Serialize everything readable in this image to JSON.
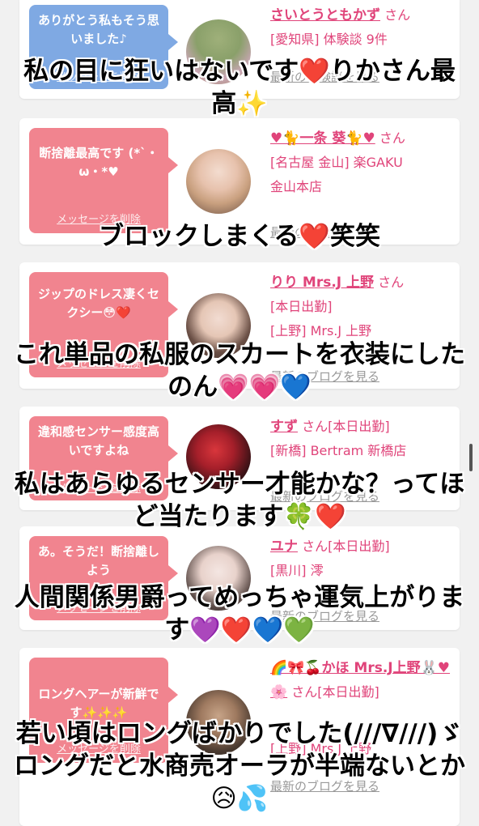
{
  "cards": [
    {
      "bubble_color": "blue",
      "message": "ありがとう私もそう思いました♪",
      "delete": "メッセージを削除",
      "name": "さいとうともかず",
      "san": "さん",
      "tags": [
        "[愛知県] 体験談 9件"
      ],
      "blog": "最新の体験談を見る"
    },
    {
      "bubble_color": "pink",
      "message": "断捨離最高です (*ˋ・ω・*♥",
      "delete": "メッセージを削除",
      "name": "♥🐈一条 葵🐈♥",
      "san": "さん",
      "tags": [
        "[名古屋 金山] 楽GAKU",
        "金山本店"
      ],
      "blog": "最新のブログを見る"
    },
    {
      "bubble_color": "pink",
      "message": "ジップのドレス凄くセクシー😳❤️",
      "delete": "メッセージを削除",
      "name": "りり Mrs.J 上野",
      "san": "さん",
      "tags": [
        "[本日出勤]",
        "[上野] Mrs.J 上野"
      ],
      "blog": "最新のブログを見る"
    },
    {
      "bubble_color": "pink",
      "message": "違和感センサー感度高いですよね",
      "delete": "メッセージを削除",
      "name": "すず",
      "san": "さん[本日出勤]",
      "tags": [
        "[新橋] Bertram 新橋店"
      ],
      "blog": "最新のブログを見る"
    },
    {
      "bubble_color": "pink",
      "message": "あ。そうだ！断捨離しよう",
      "delete": "メッセージを削除",
      "name": "ユナ",
      "san": "さん[本日出勤]",
      "tags": [
        "[黒川] 澪"
      ],
      "blog": "最新のブログを見る"
    },
    {
      "bubble_color": "pink",
      "message": "ロングヘアーが新鮮です✨✨✨",
      "delete": "メッセージを削除",
      "name": "🌈🎀🍒かほ Mrs.J上野🐰♥🌸",
      "san": "さん[本日出勤]",
      "tags": [
        "[上野] Mrs.J 上野"
      ],
      "blog": "最新のブログを見る"
    }
  ],
  "captions": [
    "私の目に狂いはないです❤️りかさん最高✨",
    "ブロックしまくる❤️笑笑",
    "これ単品の私服のスカートを衣装にしたのん💗💗💙",
    "私はあらゆるセンサー才能かな？ってほど当たります🍀❤️",
    "人間関係男爵ってめっちゃ運気上がります💜❤️💙💚",
    "若い頃はロングばかりでした(///∇///)ゞロングだと水商売オーラが半端ないとか😥💦"
  ]
}
